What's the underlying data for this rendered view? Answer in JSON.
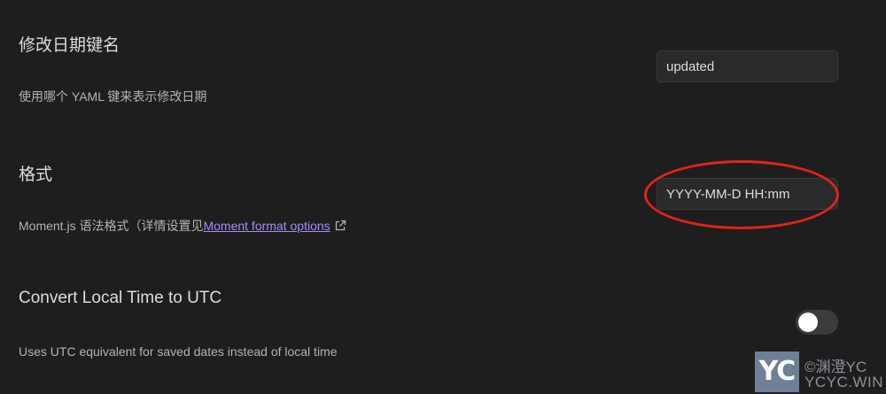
{
  "settings": [
    {
      "title": "修改日期键名",
      "description": "使用哪个 YAML 键来表示修改日期",
      "input_value": "updated"
    },
    {
      "title": "格式",
      "description_prefix": "Moment.js 语法格式（详情设置见",
      "link_text": "Moment format options",
      "input_value": "YYYY-MM-D HH:mm"
    },
    {
      "title": "Convert Local Time to UTC",
      "description": "Uses UTC equivalent for saved dates instead of local time",
      "toggle_on": false
    }
  ],
  "icons": {
    "external_link": "external-link-icon"
  },
  "annotation": {
    "color": "#e0231c"
  },
  "watermark": {
    "logo": "YC",
    "line1": "©渊澄YC",
    "line2": "YCYC.WIN"
  },
  "colors": {
    "background": "#1e1e1e",
    "link": "#a88bfa",
    "annotation": "#e0231c"
  }
}
